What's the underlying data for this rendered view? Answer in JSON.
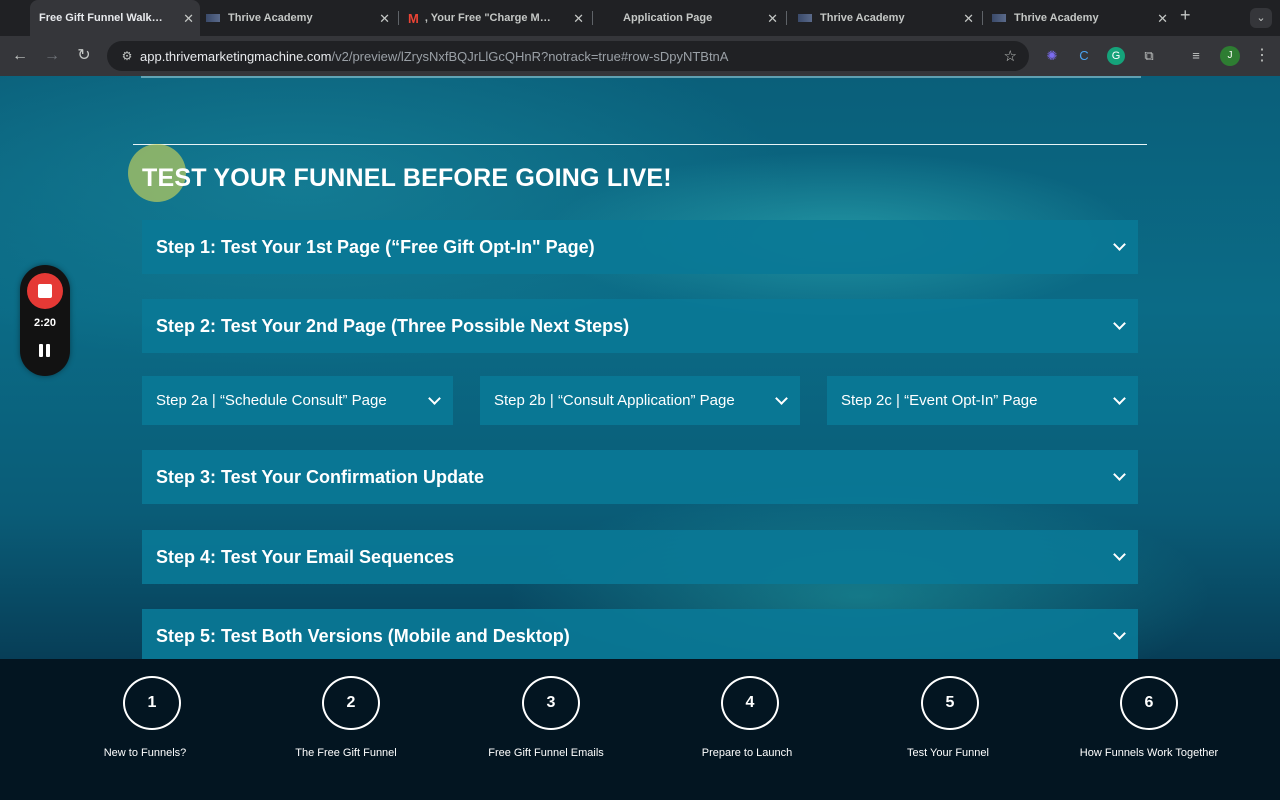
{
  "browser": {
    "tabs": [
      {
        "title": "Free Gift Funnel Walkthro",
        "active": true
      },
      {
        "title": "Thrive Academy"
      },
      {
        "title": ", Your Free \"Charge More"
      },
      {
        "title": "Application Page"
      },
      {
        "title": "Thrive Academy"
      },
      {
        "title": "Thrive Academy"
      }
    ],
    "new_tab": "+",
    "url_host": "app.thrivemarketingmachine.com",
    "url_path": "/v2/preview/lZrysNxfBQJrLlGcQHnR?notrack=true#row-sDpyNTBtnA",
    "avatar_letter": "J"
  },
  "recorder": {
    "time": "2:20"
  },
  "page": {
    "heading": "TEST YOUR FUNNEL BEFORE GOING LIVE!",
    "steps": [
      {
        "label": "Step 1: Test Your 1st Page (“Free Gift Opt-In\" Page)"
      },
      {
        "label": "Step 2: Test Your 2nd Page (Three Possible Next Steps)"
      },
      {
        "label": "Step 3: Test Your Confirmation Update"
      },
      {
        "label": "Step 4: Test Your Email Sequences"
      },
      {
        "label": "Step 5: Test Both Versions (Mobile and Desktop)"
      }
    ],
    "substeps": [
      {
        "label": "Step 2a | “Schedule Consult” Page"
      },
      {
        "label": "Step 2b | “Consult Application” Page"
      },
      {
        "label": "Step 2c | “Event Opt-In” Page"
      }
    ]
  },
  "bottom_nav": [
    {
      "number": "1",
      "label": "New to Funnels?"
    },
    {
      "number": "2",
      "label": "The Free Gift Funnel"
    },
    {
      "number": "3",
      "label": "Free Gift Funnel Emails"
    },
    {
      "number": "4",
      "label": "Prepare to Launch"
    },
    {
      "number": "5",
      "label": "Test Your Funnel"
    },
    {
      "number": "6",
      "label": "How Funnels Work Together"
    }
  ],
  "colors": {
    "accordion": "#0a7896",
    "bottom_nav_bg": "#031521",
    "record_red": "#e53935"
  }
}
